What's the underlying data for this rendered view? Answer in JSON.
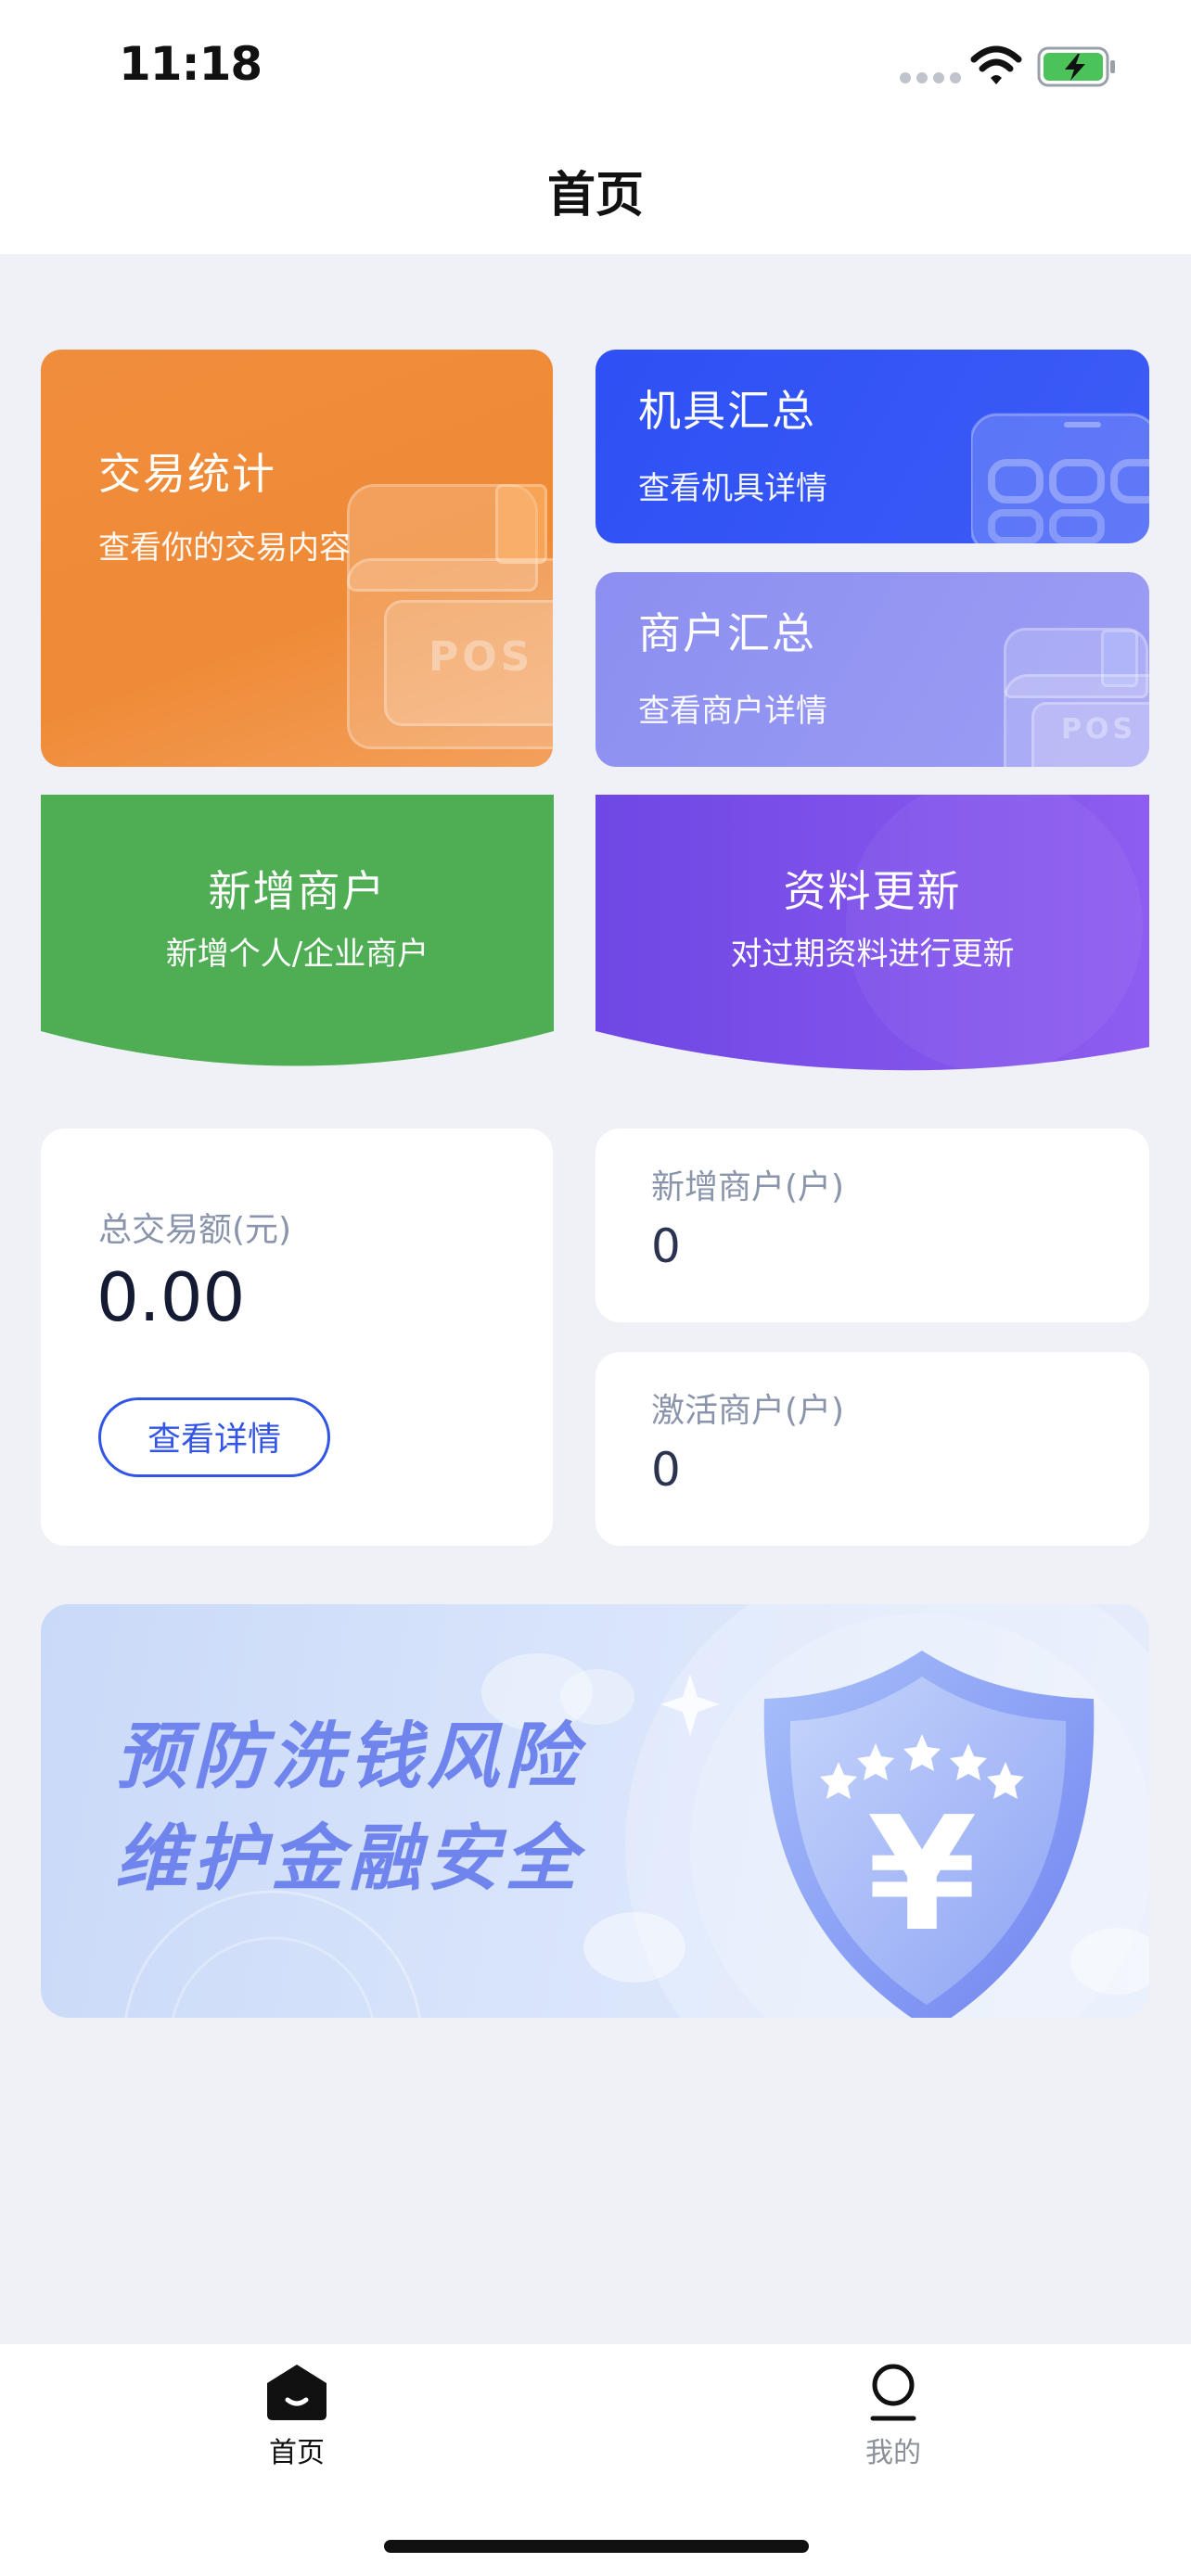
{
  "status_bar": {
    "time": "11:18"
  },
  "header": {
    "title": "首页"
  },
  "quick_cards": {
    "trade": {
      "title": "交易统计",
      "subtitle": "查看你的交易内容",
      "deco_text": "POS"
    },
    "machine": {
      "title": "机具汇总",
      "subtitle": "查看机具详情"
    },
    "merchant": {
      "title": "商户汇总",
      "subtitle": "查看商户详情",
      "deco_text": "POS"
    },
    "new_merchant": {
      "title": "新增商户",
      "subtitle": "新增个人/企业商户"
    },
    "update_info": {
      "title": "资料更新",
      "subtitle": "对过期资料进行更新"
    }
  },
  "stats": {
    "total_label": "总交易额(元)",
    "total_value": "0.00",
    "detail_button": "查看详情",
    "new_merchants_label": "新增商户(户)",
    "new_merchants_value": "0",
    "active_merchants_label": "激活商户(户)",
    "active_merchants_value": "0"
  },
  "banner": {
    "line1": "预防洗钱风险",
    "line2": "维护金融安全",
    "shield_symbol": "¥"
  },
  "tab_bar": {
    "items": [
      {
        "label": "首页",
        "icon": "home-icon",
        "active": true
      },
      {
        "label": "我的",
        "icon": "profile-icon",
        "active": false
      }
    ]
  },
  "colors": {
    "orange": "#ef8a36",
    "blue": "#3355e6",
    "lavender": "#9597f2",
    "green": "#4fae54",
    "purple": "#7a4ee8",
    "page_bg": "#f0f1f6"
  }
}
